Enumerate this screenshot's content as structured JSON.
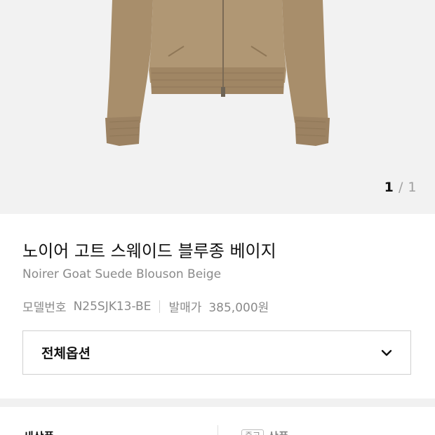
{
  "gallery": {
    "current": "1",
    "separator": "/",
    "total": "1",
    "image_alt": "beige suede blouson jacket"
  },
  "product": {
    "title": "노이어 고트 스웨이드 블루종 베이지",
    "subtitle": "Noirer Goat Suede Blouson Beige",
    "model_label": "모델번호",
    "model_value": "N25SJK13-BE",
    "price_label": "발매가",
    "price_value": "385,000원"
  },
  "options": {
    "label": "전체옵션",
    "icon": "chevron-down-icon"
  },
  "tabs": {
    "new_label": "새상품",
    "used_badge": "중고",
    "used_label": "상품"
  },
  "colors": {
    "gallery_bg": "#f2f2f2",
    "jacket": "#b09774",
    "band_bg": "#f1f1f1"
  }
}
